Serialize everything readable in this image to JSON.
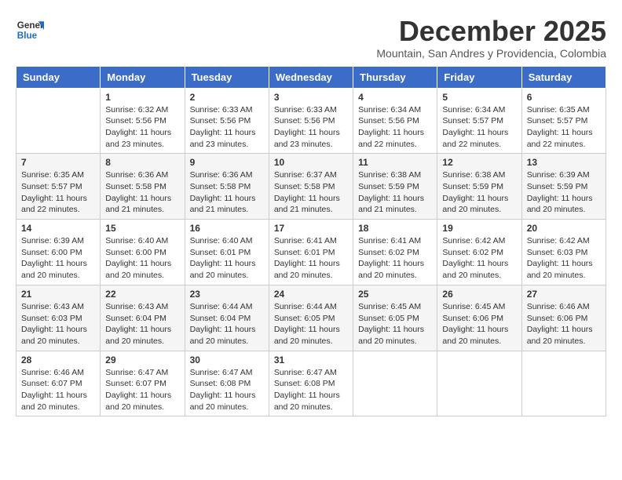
{
  "header": {
    "logo_general": "General",
    "logo_blue": "Blue",
    "month_title": "December 2025",
    "subtitle": "Mountain, San Andres y Providencia, Colombia"
  },
  "days_of_week": [
    "Sunday",
    "Monday",
    "Tuesday",
    "Wednesday",
    "Thursday",
    "Friday",
    "Saturday"
  ],
  "weeks": [
    [
      {
        "day": "",
        "sunrise": "",
        "sunset": "",
        "daylight": ""
      },
      {
        "day": "1",
        "sunrise": "Sunrise: 6:32 AM",
        "sunset": "Sunset: 5:56 PM",
        "daylight": "Daylight: 11 hours and 23 minutes."
      },
      {
        "day": "2",
        "sunrise": "Sunrise: 6:33 AM",
        "sunset": "Sunset: 5:56 PM",
        "daylight": "Daylight: 11 hours and 23 minutes."
      },
      {
        "day": "3",
        "sunrise": "Sunrise: 6:33 AM",
        "sunset": "Sunset: 5:56 PM",
        "daylight": "Daylight: 11 hours and 23 minutes."
      },
      {
        "day": "4",
        "sunrise": "Sunrise: 6:34 AM",
        "sunset": "Sunset: 5:56 PM",
        "daylight": "Daylight: 11 hours and 22 minutes."
      },
      {
        "day": "5",
        "sunrise": "Sunrise: 6:34 AM",
        "sunset": "Sunset: 5:57 PM",
        "daylight": "Daylight: 11 hours and 22 minutes."
      },
      {
        "day": "6",
        "sunrise": "Sunrise: 6:35 AM",
        "sunset": "Sunset: 5:57 PM",
        "daylight": "Daylight: 11 hours and 22 minutes."
      }
    ],
    [
      {
        "day": "7",
        "sunrise": "Sunrise: 6:35 AM",
        "sunset": "Sunset: 5:57 PM",
        "daylight": "Daylight: 11 hours and 22 minutes."
      },
      {
        "day": "8",
        "sunrise": "Sunrise: 6:36 AM",
        "sunset": "Sunset: 5:58 PM",
        "daylight": "Daylight: 11 hours and 21 minutes."
      },
      {
        "day": "9",
        "sunrise": "Sunrise: 6:36 AM",
        "sunset": "Sunset: 5:58 PM",
        "daylight": "Daylight: 11 hours and 21 minutes."
      },
      {
        "day": "10",
        "sunrise": "Sunrise: 6:37 AM",
        "sunset": "Sunset: 5:58 PM",
        "daylight": "Daylight: 11 hours and 21 minutes."
      },
      {
        "day": "11",
        "sunrise": "Sunrise: 6:38 AM",
        "sunset": "Sunset: 5:59 PM",
        "daylight": "Daylight: 11 hours and 21 minutes."
      },
      {
        "day": "12",
        "sunrise": "Sunrise: 6:38 AM",
        "sunset": "Sunset: 5:59 PM",
        "daylight": "Daylight: 11 hours and 20 minutes."
      },
      {
        "day": "13",
        "sunrise": "Sunrise: 6:39 AM",
        "sunset": "Sunset: 5:59 PM",
        "daylight": "Daylight: 11 hours and 20 minutes."
      }
    ],
    [
      {
        "day": "14",
        "sunrise": "Sunrise: 6:39 AM",
        "sunset": "Sunset: 6:00 PM",
        "daylight": "Daylight: 11 hours and 20 minutes."
      },
      {
        "day": "15",
        "sunrise": "Sunrise: 6:40 AM",
        "sunset": "Sunset: 6:00 PM",
        "daylight": "Daylight: 11 hours and 20 minutes."
      },
      {
        "day": "16",
        "sunrise": "Sunrise: 6:40 AM",
        "sunset": "Sunset: 6:01 PM",
        "daylight": "Daylight: 11 hours and 20 minutes."
      },
      {
        "day": "17",
        "sunrise": "Sunrise: 6:41 AM",
        "sunset": "Sunset: 6:01 PM",
        "daylight": "Daylight: 11 hours and 20 minutes."
      },
      {
        "day": "18",
        "sunrise": "Sunrise: 6:41 AM",
        "sunset": "Sunset: 6:02 PM",
        "daylight": "Daylight: 11 hours and 20 minutes."
      },
      {
        "day": "19",
        "sunrise": "Sunrise: 6:42 AM",
        "sunset": "Sunset: 6:02 PM",
        "daylight": "Daylight: 11 hours and 20 minutes."
      },
      {
        "day": "20",
        "sunrise": "Sunrise: 6:42 AM",
        "sunset": "Sunset: 6:03 PM",
        "daylight": "Daylight: 11 hours and 20 minutes."
      }
    ],
    [
      {
        "day": "21",
        "sunrise": "Sunrise: 6:43 AM",
        "sunset": "Sunset: 6:03 PM",
        "daylight": "Daylight: 11 hours and 20 minutes."
      },
      {
        "day": "22",
        "sunrise": "Sunrise: 6:43 AM",
        "sunset": "Sunset: 6:04 PM",
        "daylight": "Daylight: 11 hours and 20 minutes."
      },
      {
        "day": "23",
        "sunrise": "Sunrise: 6:44 AM",
        "sunset": "Sunset: 6:04 PM",
        "daylight": "Daylight: 11 hours and 20 minutes."
      },
      {
        "day": "24",
        "sunrise": "Sunrise: 6:44 AM",
        "sunset": "Sunset: 6:05 PM",
        "daylight": "Daylight: 11 hours and 20 minutes."
      },
      {
        "day": "25",
        "sunrise": "Sunrise: 6:45 AM",
        "sunset": "Sunset: 6:05 PM",
        "daylight": "Daylight: 11 hours and 20 minutes."
      },
      {
        "day": "26",
        "sunrise": "Sunrise: 6:45 AM",
        "sunset": "Sunset: 6:06 PM",
        "daylight": "Daylight: 11 hours and 20 minutes."
      },
      {
        "day": "27",
        "sunrise": "Sunrise: 6:46 AM",
        "sunset": "Sunset: 6:06 PM",
        "daylight": "Daylight: 11 hours and 20 minutes."
      }
    ],
    [
      {
        "day": "28",
        "sunrise": "Sunrise: 6:46 AM",
        "sunset": "Sunset: 6:07 PM",
        "daylight": "Daylight: 11 hours and 20 minutes."
      },
      {
        "day": "29",
        "sunrise": "Sunrise: 6:47 AM",
        "sunset": "Sunset: 6:07 PM",
        "daylight": "Daylight: 11 hours and 20 minutes."
      },
      {
        "day": "30",
        "sunrise": "Sunrise: 6:47 AM",
        "sunset": "Sunset: 6:08 PM",
        "daylight": "Daylight: 11 hours and 20 minutes."
      },
      {
        "day": "31",
        "sunrise": "Sunrise: 6:47 AM",
        "sunset": "Sunset: 6:08 PM",
        "daylight": "Daylight: 11 hours and 20 minutes."
      },
      {
        "day": "",
        "sunrise": "",
        "sunset": "",
        "daylight": ""
      },
      {
        "day": "",
        "sunrise": "",
        "sunset": "",
        "daylight": ""
      },
      {
        "day": "",
        "sunrise": "",
        "sunset": "",
        "daylight": ""
      }
    ]
  ]
}
